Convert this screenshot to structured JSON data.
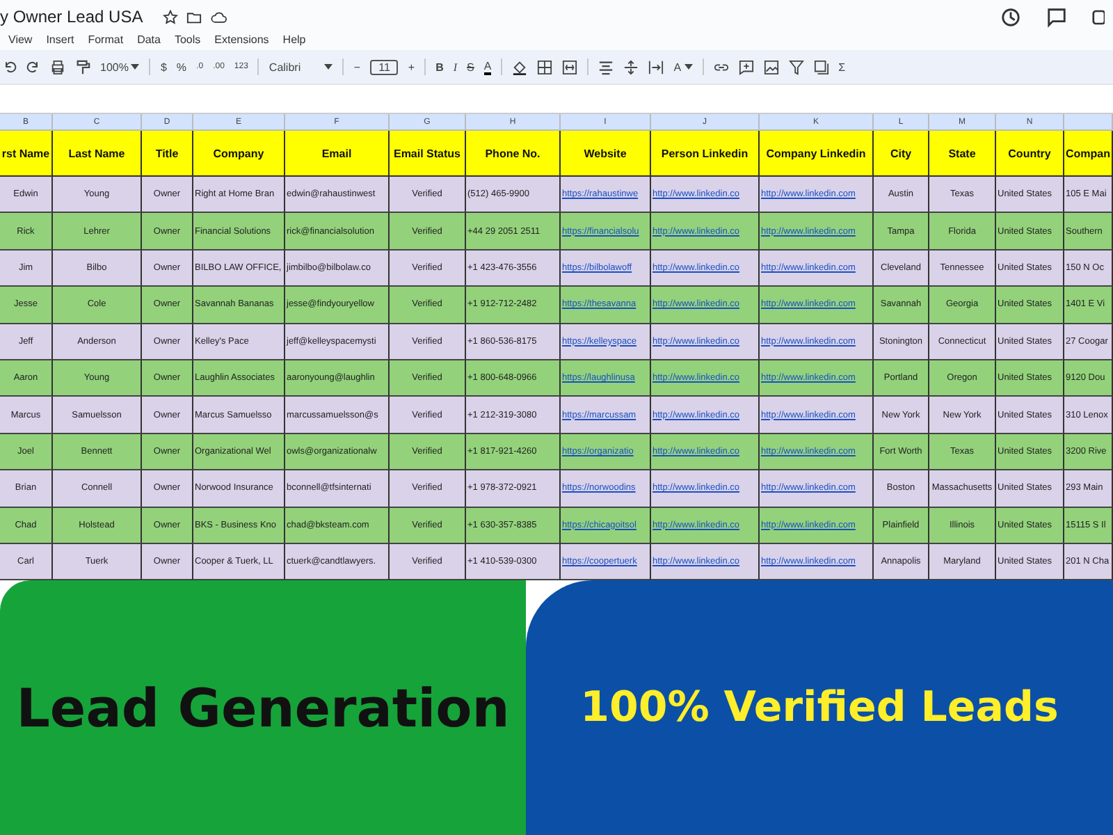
{
  "document_title": "y Owner Lead USA",
  "menu": [
    "View",
    "Insert",
    "Format",
    "Data",
    "Tools",
    "Extensions",
    "Help"
  ],
  "toolbar": {
    "zoom": "100%",
    "currency": "$",
    "percent": "%",
    "decimal_decrease": ".0",
    "decimal_increase": ".00",
    "number_format": "123",
    "font": "Calibri",
    "size_decrease": "−",
    "font_size": "11",
    "size_increase": "+",
    "bold": "B",
    "italic": "I",
    "strikethrough": "S",
    "text_color": "A",
    "text_rotation": "A",
    "functions": "Σ"
  },
  "column_letters": [
    "B",
    "C",
    "D",
    "E",
    "F",
    "G",
    "H",
    "I",
    "J",
    "K",
    "L",
    "M",
    "N"
  ],
  "table": {
    "columns": [
      {
        "label": "rst Name",
        "kind": "centered"
      },
      {
        "label": "Last Name",
        "kind": "centered"
      },
      {
        "label": "Title",
        "kind": "centered"
      },
      {
        "label": "Company",
        "kind": "plain"
      },
      {
        "label": "Email",
        "kind": "plain"
      },
      {
        "label": "Email Status",
        "kind": "centered"
      },
      {
        "label": "Phone No.",
        "kind": "plain"
      },
      {
        "label": "Website",
        "kind": "link"
      },
      {
        "label": "Person Linkedin",
        "kind": "link"
      },
      {
        "label": "Company Linkedin",
        "kind": "link"
      },
      {
        "label": "City",
        "kind": "centered"
      },
      {
        "label": "State",
        "kind": "centered"
      },
      {
        "label": "Country",
        "kind": "plain"
      },
      {
        "label": "Compan",
        "kind": "plain"
      }
    ],
    "rows": [
      {
        "color": "#d9d2e9",
        "cells": [
          "Edwin",
          "Young",
          "Owner",
          "Right at Home Bran",
          "edwin@rahaustinwest",
          "Verified",
          "(512) 465-9900",
          "https://rahaustinwe",
          "http://www.linkedin.co",
          "http://www.linkedin.com",
          "Austin",
          "Texas",
          "United States",
          "105 E Mai"
        ]
      },
      {
        "color": "#93d27b",
        "cells": [
          "Rick",
          "Lehrer",
          "Owner",
          "Financial Solutions",
          "rick@financialsolution",
          "Verified",
          "+44 29 2051 2511",
          "https://financialsolu",
          "http://www.linkedin.co",
          "http://www.linkedin.com",
          "Tampa",
          "Florida",
          "United States",
          "Southern"
        ]
      },
      {
        "color": "#d9d2e9",
        "cells": [
          "Jim",
          "Bilbo",
          "Owner",
          "BILBO LAW OFFICE,",
          "jimbilbo@bilbolaw.co",
          "Verified",
          "+1 423-476-3556",
          "https://bilbolawoff",
          "http://www.linkedin.co",
          "http://www.linkedin.com",
          "Cleveland",
          "Tennessee",
          "United States",
          "150 N Oc"
        ]
      },
      {
        "color": "#93d27b",
        "cells": [
          "Jesse",
          "Cole",
          "Owner",
          "Savannah Bananas",
          "jesse@findyouryellow",
          "Verified",
          "+1 912-712-2482",
          "https://thesavanna",
          "http://www.linkedin.co",
          "http://www.linkedin.com",
          "Savannah",
          "Georgia",
          "United States",
          "1401 E Vi"
        ]
      },
      {
        "color": "#d9d2e9",
        "cells": [
          "Jeff",
          "Anderson",
          "Owner",
          "Kelley's Pace",
          "jeff@kelleyspacemysti",
          "Verified",
          "+1 860-536-8175",
          "https://kelleyspace",
          "http://www.linkedin.co",
          "http://www.linkedin.com",
          "Stonington",
          "Connecticut",
          "United States",
          "27 Coogar"
        ]
      },
      {
        "color": "#93d27b",
        "cells": [
          "Aaron",
          "Young",
          "Owner",
          "Laughlin Associates",
          "aaronyoung@laughlin",
          "Verified",
          "+1 800-648-0966",
          "https://laughlinusa",
          "http://www.linkedin.co",
          "http://www.linkedin.com",
          "Portland",
          "Oregon",
          "United States",
          "9120 Dou"
        ]
      },
      {
        "color": "#d9d2e9",
        "cells": [
          "Marcus",
          "Samuelsson",
          "Owner",
          "Marcus Samuelsso",
          "marcussamuelsson@s",
          "Verified",
          "+1 212-319-3080",
          "https://marcussam",
          "http://www.linkedin.co",
          "http://www.linkedin.com",
          "New York",
          "New York",
          "United States",
          "310 Lenox"
        ]
      },
      {
        "color": "#93d27b",
        "cells": [
          "Joel",
          "Bennett",
          "Owner",
          "Organizational Wel",
          "owls@organizationalw",
          "Verified",
          "+1 817-921-4260",
          "https://organizatio",
          "http://www.linkedin.co",
          "http://www.linkedin.com",
          "Fort Worth",
          "Texas",
          "United States",
          "3200 Rive"
        ]
      },
      {
        "color": "#d9d2e9",
        "cells": [
          "Brian",
          "Connell",
          "Owner",
          "Norwood Insurance",
          "bconnell@tfsinternati",
          "Verified",
          "+1 978-372-0921",
          "https://norwoodins",
          "http://www.linkedin.co",
          "http://www.linkedin.com",
          "Boston",
          "Massachusetts",
          "United States",
          "293 Main"
        ]
      },
      {
        "color": "#93d27b",
        "cells": [
          "Chad",
          "Holstead",
          "Owner",
          "BKS - Business Kno",
          "chad@bksteam.com",
          "Verified",
          "+1 630-357-8385",
          "https://chicagoitsol",
          "http://www.linkedin.co",
          "http://www.linkedin.com",
          "Plainfield",
          "Illinois",
          "United States",
          "15115 S Il"
        ]
      },
      {
        "color": "#d9d2e9",
        "cells": [
          "Carl",
          "Tuerk",
          "Owner",
          "Cooper & Tuerk, LL",
          "ctuerk@candtlawyers.",
          "Verified",
          "+1 410-539-0300",
          "https://coopertuerk",
          "http://www.linkedin.co",
          "http://www.linkedin.com",
          "Annapolis",
          "Maryland",
          "United States",
          "201 N Cha"
        ]
      }
    ]
  },
  "banners": [
    {
      "text": "Lead Generation",
      "color": "#16a33a"
    },
    {
      "text": "100% Verified Leads",
      "color": "#0b50a6"
    }
  ]
}
